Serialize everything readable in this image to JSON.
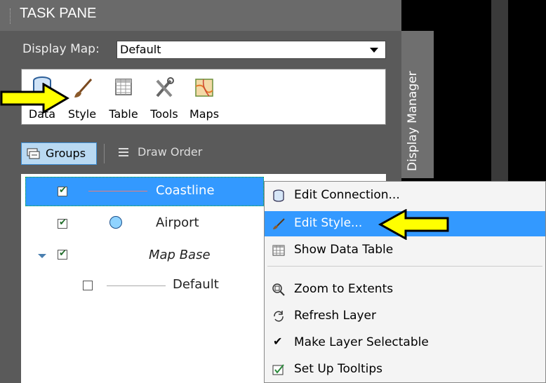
{
  "pane": {
    "title": "TASK PANE",
    "display_map_label": "Display Map:",
    "display_map_value": "Default",
    "vertical_tab": "Display Manager"
  },
  "toolbar": {
    "data_label": "Data",
    "style_label": "Style",
    "table_label": "Table",
    "tools_label": "Tools",
    "maps_label": "Maps"
  },
  "view_tabs": {
    "groups_label": "Groups",
    "draw_order_label": "Draw Order"
  },
  "layers": [
    {
      "name": "Coastline",
      "checked": true,
      "selected": true,
      "style": "line"
    },
    {
      "name": "Airport",
      "checked": true,
      "selected": false,
      "style": "circle"
    },
    {
      "name": "Map Base",
      "checked": true,
      "selected": false,
      "style": "group"
    },
    {
      "name": "Default",
      "checked": false,
      "selected": false,
      "style": "line"
    }
  ],
  "context_menu": {
    "edit_connection": "Edit Connection...",
    "edit_style": "Edit Style...",
    "show_data_table": "Show Data Table",
    "zoom_to_extents": "Zoom to Extents",
    "refresh_layer": "Refresh Layer",
    "make_selectable": "Make Layer Selectable",
    "set_up_tooltips": "Set Up Tooltips"
  },
  "colors": {
    "selection": "#3399ff",
    "menu_highlight": "#3399ff",
    "callout_arrow": "#ffff00"
  }
}
